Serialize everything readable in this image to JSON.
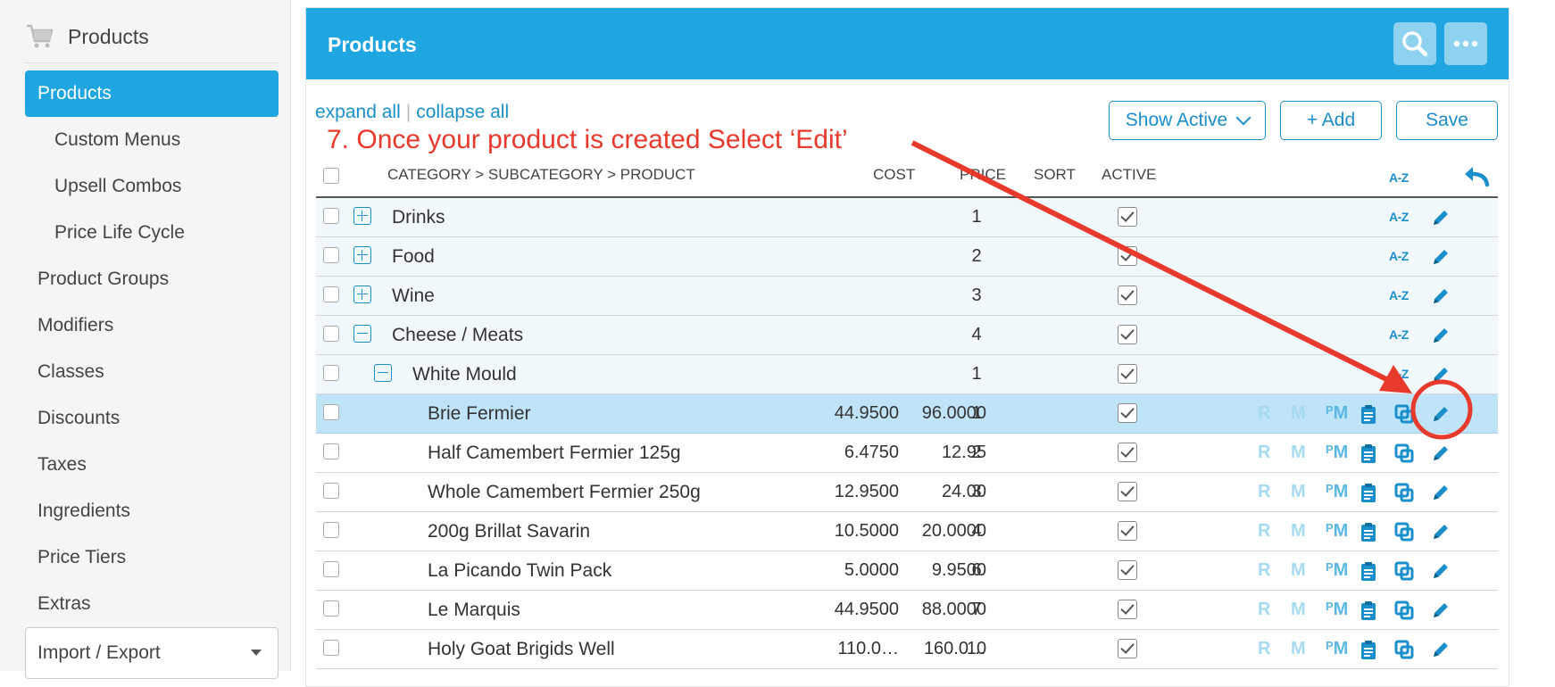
{
  "sidebar": {
    "header": "Products",
    "items": [
      {
        "label": "Products",
        "active": true,
        "sub": false
      },
      {
        "label": "Custom Menus",
        "sub": true
      },
      {
        "label": "Upsell Combos",
        "sub": true
      },
      {
        "label": "Price Life Cycle",
        "sub": true
      },
      {
        "label": "Product Groups",
        "sub": false
      },
      {
        "label": "Modifiers",
        "sub": false
      },
      {
        "label": "Classes",
        "sub": false
      },
      {
        "label": "Discounts",
        "sub": false
      },
      {
        "label": "Taxes",
        "sub": false
      },
      {
        "label": "Ingredients",
        "sub": false
      },
      {
        "label": "Price Tiers",
        "sub": false
      },
      {
        "label": "Extras",
        "sub": false
      }
    ],
    "import_export": "Import / Export"
  },
  "header": {
    "title": "Products"
  },
  "toolbar": {
    "expand_all": "expand all",
    "collapse_all": "collapse all",
    "separator": "|",
    "show_active": "Show Active",
    "add": "+ Add",
    "save": "Save"
  },
  "annotation": "7. Once your product is created Select ‘Edit’",
  "columns": {
    "category": "CATEGORY > SUBCATEGORY > PRODUCT",
    "cost": "COST",
    "price": "PRICE",
    "sort": "SORT",
    "active": "ACTIVE",
    "az": "A-Z"
  },
  "rows": [
    {
      "type": "category",
      "expanded": false,
      "name": "Drinks",
      "sort": "1"
    },
    {
      "type": "category",
      "expanded": false,
      "name": "Food",
      "sort": "2"
    },
    {
      "type": "category",
      "expanded": false,
      "name": "Wine",
      "sort": "3"
    },
    {
      "type": "category",
      "expanded": true,
      "name": "Cheese / Meats",
      "sort": "4"
    },
    {
      "type": "subcategory",
      "expanded": true,
      "name": "White Mould",
      "sort": "1"
    },
    {
      "type": "product",
      "selected": true,
      "name": "Brie Fermier",
      "cost": "44.9500",
      "price": "96.0000",
      "sort": "1"
    },
    {
      "type": "product",
      "name": "Half Camembert Fermier 125g",
      "cost": "6.4750",
      "price": "12.95",
      "sort": "2"
    },
    {
      "type": "product",
      "name": "Whole Camembert Fermier 250g",
      "cost": "12.9500",
      "price": "24.00",
      "sort": "3"
    },
    {
      "type": "product",
      "name": "200g Brillat Savarin",
      "cost": "10.5000",
      "price": "20.0000",
      "sort": "4"
    },
    {
      "type": "product",
      "name": "La Picando Twin Pack",
      "cost": "5.0000",
      "price": "9.9500",
      "sort": "6"
    },
    {
      "type": "product",
      "name": "Le Marquis",
      "cost": "44.9500",
      "price": "88.0000",
      "sort": "7"
    },
    {
      "type": "product",
      "name": "Holy Goat Brigids Well",
      "cost": "110.0…",
      "price": "160.0…",
      "sort": "10"
    }
  ],
  "row_action_letters": {
    "r": "R",
    "m": "M",
    "pm": "M"
  },
  "colors": {
    "accent": "#1fa5e0",
    "link": "#1a8fcc",
    "annotation": "#e8392d",
    "selected_row": "#bfe4f7"
  }
}
